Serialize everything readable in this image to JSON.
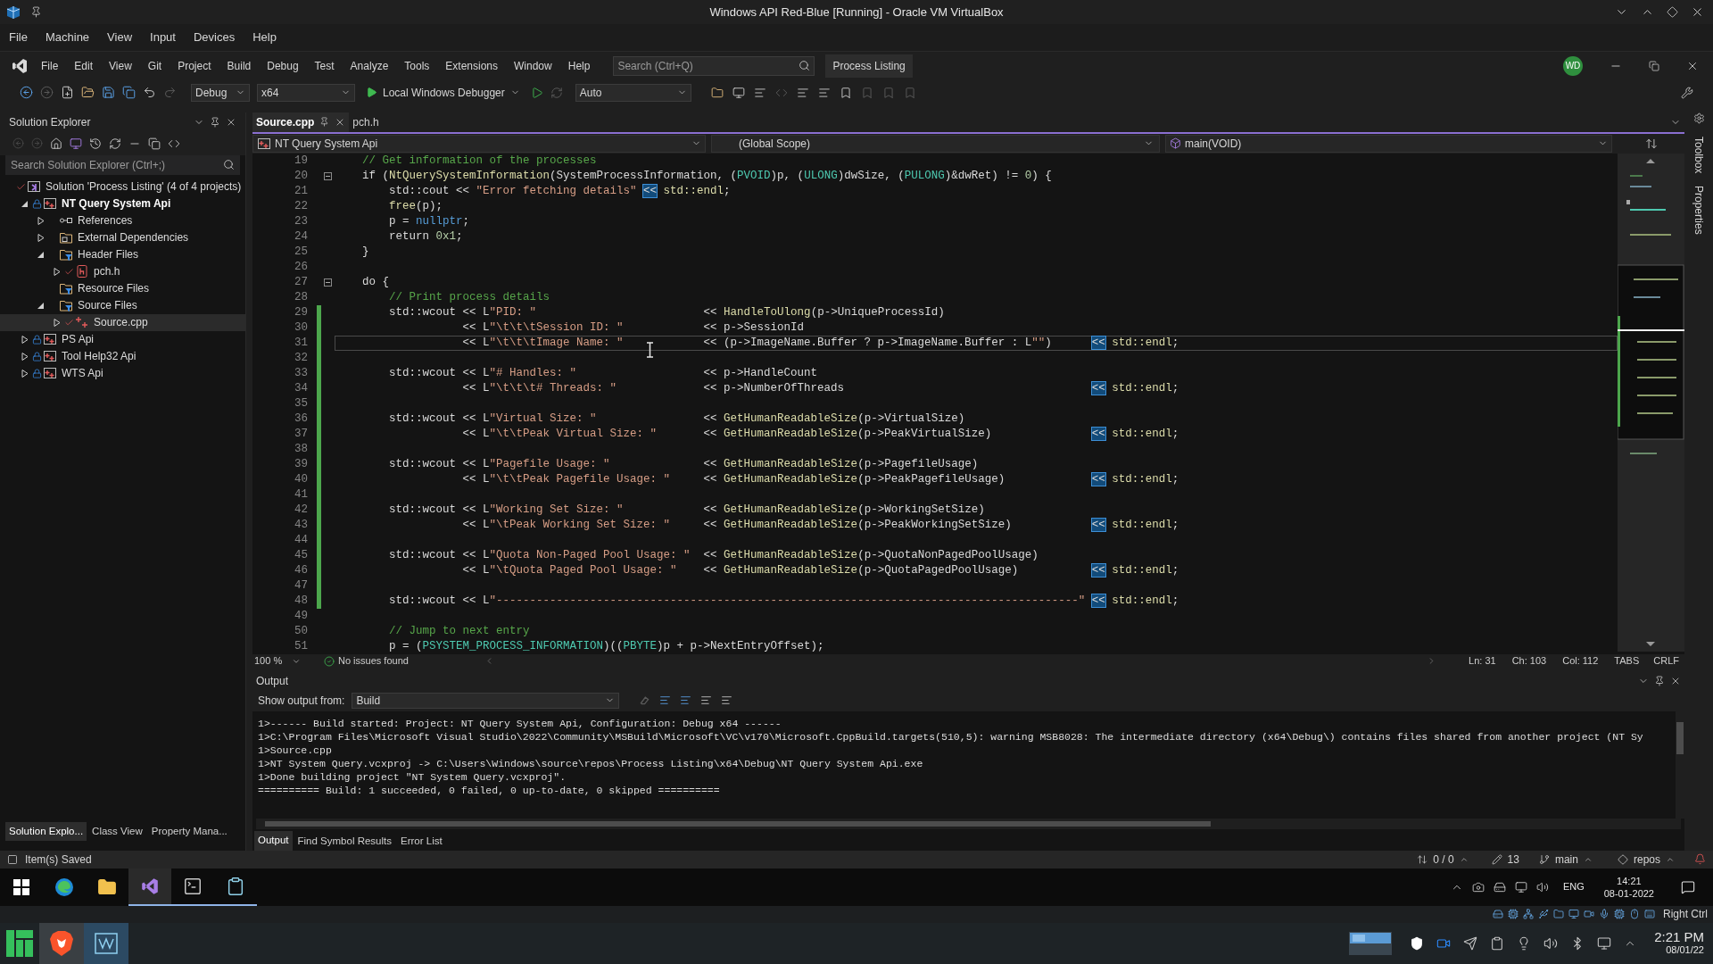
{
  "vbox": {
    "title": "Windows API Red-Blue [Running] - Oracle VM VirtualBox",
    "menu": [
      "File",
      "Machine",
      "View",
      "Input",
      "Devices",
      "Help"
    ]
  },
  "vs": {
    "menu": [
      "File",
      "Edit",
      "View",
      "Git",
      "Project",
      "Build",
      "Debug",
      "Test",
      "Analyze",
      "Tools",
      "Extensions",
      "Window",
      "Help"
    ],
    "search": {
      "placeholder": "Search (Ctrl+Q)"
    },
    "solution_name": "Process Listing",
    "account": "WD",
    "toolbar": {
      "configuration": "Debug",
      "platform": "x64",
      "debugger": "Local Windows Debugger",
      "mode": "Auto"
    },
    "solution_explorer": {
      "title": "Solution Explorer",
      "search": {
        "placeholder": "Search Solution Explorer (Ctrl+;)"
      },
      "tree": [
        {
          "label": "Solution 'Process Listing' (4 of 4 projects)",
          "kind": "solution",
          "selected": false,
          "locked": false,
          "checked_in": true,
          "children": [
            {
              "label": "NT Query System Api",
              "kind": "project",
              "startup": true,
              "expanded": true,
              "selected": false,
              "locked": true,
              "checked_in": false,
              "children": [
                {
                  "label": "References",
                  "kind": "references",
                  "expanded": false,
                  "selected": false,
                  "locked": false,
                  "checked_in": false
                },
                {
                  "label": "External Dependencies",
                  "kind": "dependencies",
                  "expanded": false,
                  "selected": false,
                  "locked": false,
                  "checked_in": false
                },
                {
                  "label": "Header Files",
                  "kind": "filter",
                  "expanded": true,
                  "selected": false,
                  "locked": false,
                  "checked_in": false,
                  "children": [
                    {
                      "label": "pch.h",
                      "kind": "header",
                      "expanded": false,
                      "selected": false,
                      "locked": false,
                      "checked_in": true
                    }
                  ]
                },
                {
                  "label": "Resource Files",
                  "kind": "filter",
                  "selected": false,
                  "locked": false,
                  "checked_in": false
                },
                {
                  "label": "Source Files",
                  "kind": "filter",
                  "expanded": true,
                  "selected": false,
                  "locked": false,
                  "checked_in": false,
                  "children": [
                    {
                      "label": "Source.cpp",
                      "kind": "source",
                      "expanded": false,
                      "selected": true,
                      "locked": false,
                      "checked_in": true
                    }
                  ]
                }
              ]
            },
            {
              "label": "PS Api",
              "kind": "project",
              "startup": false,
              "expanded": false,
              "selected": false,
              "locked": true,
              "checked_in": false
            },
            {
              "label": "Tool Help32 Api",
              "kind": "project",
              "startup": false,
              "expanded": false,
              "selected": false,
              "locked": true,
              "checked_in": false
            },
            {
              "label": "WTS Api",
              "kind": "project",
              "startup": false,
              "expanded": false,
              "selected": false,
              "locked": true,
              "checked_in": false
            }
          ]
        }
      ]
    },
    "left_tabs": [
      {
        "label": "Solution Explo...",
        "selected": true
      },
      {
        "label": "Class View",
        "selected": false
      },
      {
        "label": "Property Mana...",
        "selected": false
      }
    ],
    "editor": {
      "tabs": [
        {
          "label": "Source.cpp",
          "selected": true
        },
        {
          "label": "pch.h",
          "selected": false
        }
      ],
      "nav": [
        "NT Query System Api",
        "(Global Scope)",
        "main(VOID)"
      ],
      "lines": [
        {
          "number": "19",
          "tokens": [
            {
              "kind": "comment",
              "text": "// Get information of the processes"
            }
          ]
        },
        {
          "number": "20",
          "fold": true,
          "tokens": [
            {
              "kind": "plain",
              "text": "if ("
            },
            {
              "kind": "function",
              "text": "NtQuerySystemInformation"
            },
            {
              "kind": "plain",
              "text": "(SystemProcessInformation, ("
            },
            {
              "kind": "type",
              "text": "PVOID"
            },
            {
              "kind": "plain",
              "text": ")p, ("
            },
            {
              "kind": "type",
              "text": "ULONG"
            },
            {
              "kind": "plain",
              "text": ")dwSize, ("
            },
            {
              "kind": "type",
              "text": "PULONG"
            },
            {
              "kind": "plain",
              "text": ")&dwRet) != "
            },
            {
              "kind": "number",
              "text": "0"
            },
            {
              "kind": "plain",
              "text": ") {"
            }
          ]
        },
        {
          "number": "21",
          "tokens": [
            {
              "kind": "plain",
              "text": "    std::cout << "
            },
            {
              "kind": "string",
              "text": "\"Error fetching details\" "
            },
            {
              "kind": "match",
              "text": "<<"
            },
            {
              "kind": "function",
              "text": " std::endl"
            },
            {
              "kind": "plain",
              "text": ";"
            }
          ]
        },
        {
          "number": "22",
          "tokens": [
            {
              "kind": "function",
              "text": "    free"
            },
            {
              "kind": "plain",
              "text": "(p);"
            }
          ]
        },
        {
          "number": "23",
          "tokens": [
            {
              "kind": "plain",
              "text": "    p = "
            },
            {
              "kind": "keyword",
              "text": "nullptr"
            },
            {
              "kind": "plain",
              "text": ";"
            }
          ]
        },
        {
          "number": "24",
          "tokens": [
            {
              "kind": "plain",
              "text": "    return "
            },
            {
              "kind": "number",
              "text": "0x1"
            },
            {
              "kind": "plain",
              "text": ";"
            }
          ]
        },
        {
          "number": "25",
          "tokens": [
            {
              "kind": "plain",
              "text": "}"
            }
          ]
        },
        {
          "number": "26"
        },
        {
          "number": "27",
          "fold": true,
          "tokens": [
            {
              "kind": "plain",
              "text": "do {"
            }
          ]
        },
        {
          "number": "28",
          "tokens": [
            {
              "kind": "comment",
              "text": "    // Print process details"
            }
          ]
        },
        {
          "number": "29",
          "changed": true,
          "tokens": [
            {
              "kind": "plain",
              "text": "    std::wcout << L"
            },
            {
              "kind": "string",
              "text": "\"PID: \""
            },
            {
              "kind": "plain",
              "text": "                         << "
            },
            {
              "kind": "function",
              "text": "HandleToUlong"
            },
            {
              "kind": "plain",
              "text": "(p->UniqueProcessId)"
            }
          ]
        },
        {
          "number": "30",
          "changed": true,
          "tokens": [
            {
              "kind": "plain",
              "text": "               << L"
            },
            {
              "kind": "string",
              "text": "\"\\t\\t\\tSession ID: \""
            },
            {
              "kind": "plain",
              "text": "            << p->SessionId"
            }
          ]
        },
        {
          "number": "31",
          "changed": true,
          "current": true,
          "tokens": [
            {
              "kind": "plain",
              "text": "               << L"
            },
            {
              "kind": "string",
              "text": "\"\\t\\t\\tImage Name: \""
            },
            {
              "kind": "plain",
              "text": "            << (p->ImageName.Buffer ? p->ImageName.Buffer : L"
            },
            {
              "kind": "string",
              "text": "\"\""
            },
            {
              "kind": "plain",
              "text": ")      "
            },
            {
              "kind": "match",
              "text": "<<"
            },
            {
              "kind": "function",
              "text": " std::endl"
            },
            {
              "kind": "plain",
              "text": ";"
            }
          ]
        },
        {
          "number": "32",
          "changed": true
        },
        {
          "number": "33",
          "changed": true,
          "tokens": [
            {
              "kind": "plain",
              "text": "    std::wcout << L"
            },
            {
              "kind": "string",
              "text": "\"# Handles: \""
            },
            {
              "kind": "plain",
              "text": "                   << p->HandleCount"
            }
          ]
        },
        {
          "number": "34",
          "changed": true,
          "tokens": [
            {
              "kind": "plain",
              "text": "               << L"
            },
            {
              "kind": "string",
              "text": "\"\\t\\t\\t# Threads: \""
            },
            {
              "kind": "plain",
              "text": "             << p->NumberOfThreads                                     "
            },
            {
              "kind": "match",
              "text": "<<"
            },
            {
              "kind": "function",
              "text": " std::endl"
            },
            {
              "kind": "plain",
              "text": ";"
            }
          ]
        },
        {
          "number": "35",
          "changed": true
        },
        {
          "number": "36",
          "changed": true,
          "tokens": [
            {
              "kind": "plain",
              "text": "    std::wcout << L"
            },
            {
              "kind": "string",
              "text": "\"Virtual Size: \""
            },
            {
              "kind": "plain",
              "text": "                << "
            },
            {
              "kind": "function",
              "text": "GetHumanReadableSize"
            },
            {
              "kind": "plain",
              "text": "(p->VirtualSize)"
            }
          ]
        },
        {
          "number": "37",
          "changed": true,
          "tokens": [
            {
              "kind": "plain",
              "text": "               << L"
            },
            {
              "kind": "string",
              "text": "\"\\t\\tPeak Virtual Size: \""
            },
            {
              "kind": "plain",
              "text": "       << "
            },
            {
              "kind": "function",
              "text": "GetHumanReadableSize"
            },
            {
              "kind": "plain",
              "text": "(p->PeakVirtualSize)               "
            },
            {
              "kind": "match",
              "text": "<<"
            },
            {
              "kind": "function",
              "text": " std::endl"
            },
            {
              "kind": "plain",
              "text": ";"
            }
          ]
        },
        {
          "number": "38",
          "changed": true
        },
        {
          "number": "39",
          "changed": true,
          "tokens": [
            {
              "kind": "plain",
              "text": "    std::wcout << L"
            },
            {
              "kind": "string",
              "text": "\"Pagefile Usage: \""
            },
            {
              "kind": "plain",
              "text": "              << "
            },
            {
              "kind": "function",
              "text": "GetHumanReadableSize"
            },
            {
              "kind": "plain",
              "text": "(p->PagefileUsage)"
            }
          ]
        },
        {
          "number": "40",
          "changed": true,
          "tokens": [
            {
              "kind": "plain",
              "text": "               << L"
            },
            {
              "kind": "string",
              "text": "\"\\t\\tPeak Pagefile Usage: \""
            },
            {
              "kind": "plain",
              "text": "     << "
            },
            {
              "kind": "function",
              "text": "GetHumanReadableSize"
            },
            {
              "kind": "plain",
              "text": "(p->PeakPagefileUsage)             "
            },
            {
              "kind": "match",
              "text": "<<"
            },
            {
              "kind": "function",
              "text": " std::endl"
            },
            {
              "kind": "plain",
              "text": ";"
            }
          ]
        },
        {
          "number": "41",
          "changed": true
        },
        {
          "number": "42",
          "changed": true,
          "tokens": [
            {
              "kind": "plain",
              "text": "    std::wcout << L"
            },
            {
              "kind": "string",
              "text": "\"Working Set Size: \""
            },
            {
              "kind": "plain",
              "text": "            << "
            },
            {
              "kind": "function",
              "text": "GetHumanReadableSize"
            },
            {
              "kind": "plain",
              "text": "(p->WorkingSetSize)"
            }
          ]
        },
        {
          "number": "43",
          "changed": true,
          "tokens": [
            {
              "kind": "plain",
              "text": "               << L"
            },
            {
              "kind": "string",
              "text": "\"\\tPeak Working Set Size: \""
            },
            {
              "kind": "plain",
              "text": "     << "
            },
            {
              "kind": "function",
              "text": "GetHumanReadableSize"
            },
            {
              "kind": "plain",
              "text": "(p->PeakWorkingSetSize)            "
            },
            {
              "kind": "match",
              "text": "<<"
            },
            {
              "kind": "function",
              "text": " std::endl"
            },
            {
              "kind": "plain",
              "text": ";"
            }
          ]
        },
        {
          "number": "44",
          "changed": true
        },
        {
          "number": "45",
          "changed": true,
          "tokens": [
            {
              "kind": "plain",
              "text": "    std::wcout << L"
            },
            {
              "kind": "string",
              "text": "\"Quota Non-Paged Pool Usage: \""
            },
            {
              "kind": "plain",
              "text": "  << "
            },
            {
              "kind": "function",
              "text": "GetHumanReadableSize"
            },
            {
              "kind": "plain",
              "text": "(p->QuotaNonPagedPoolUsage)"
            }
          ]
        },
        {
          "number": "46",
          "changed": true,
          "tokens": [
            {
              "kind": "plain",
              "text": "               << L"
            },
            {
              "kind": "string",
              "text": "\"\\tQuota Paged Pool Usage: \""
            },
            {
              "kind": "plain",
              "text": "    << "
            },
            {
              "kind": "function",
              "text": "GetHumanReadableSize"
            },
            {
              "kind": "plain",
              "text": "(p->QuotaPagedPoolUsage)           "
            },
            {
              "kind": "match",
              "text": "<<"
            },
            {
              "kind": "function",
              "text": " std::endl"
            },
            {
              "kind": "plain",
              "text": ";"
            }
          ]
        },
        {
          "number": "47",
          "changed": true
        },
        {
          "number": "48",
          "changed": true,
          "tokens": [
            {
              "kind": "plain",
              "text": "    std::wcout << L"
            },
            {
              "kind": "string",
              "text": "\"---------------------------------------------------------------------------------------\" "
            },
            {
              "kind": "match",
              "text": "<<"
            },
            {
              "kind": "function",
              "text": " std::endl"
            },
            {
              "kind": "plain",
              "text": ";"
            }
          ]
        },
        {
          "number": "49"
        },
        {
          "number": "50",
          "tokens": [
            {
              "kind": "comment",
              "text": "    // Jump to next entry"
            }
          ]
        },
        {
          "number": "51",
          "tokens": [
            {
              "kind": "plain",
              "text": "    p = ("
            },
            {
              "kind": "type",
              "text": "PSYSTEM_PROCESS_INFORMATION"
            },
            {
              "kind": "plain",
              "text": ")(("
            },
            {
              "kind": "type",
              "text": "PBYTE"
            },
            {
              "kind": "plain",
              "text": ")p + p->NextEntryOffset);"
            }
          ]
        }
      ],
      "status": {
        "zoom": "100 %",
        "issues": "No issues found",
        "line": "Ln: 31",
        "char": "Ch: 103",
        "column": "Col: 112",
        "indent": "TABS",
        "line_endings": "CRLF"
      }
    },
    "output": {
      "title": "Output",
      "source_label": "Show output from:",
      "source": "Build",
      "lines": [
        "1>------ Build started: Project: NT Query System Api, Configuration: Debug x64 ------",
        "1>C:\\Program Files\\Microsoft Visual Studio\\2022\\Community\\MSBuild\\Microsoft\\VC\\v170\\Microsoft.CppBuild.targets(510,5): warning MSB8028: The intermediate directory (x64\\Debug\\) contains files shared from another project (NT Sy",
        "1>Source.cpp",
        "1>NT System Query.vcxproj -> C:\\Users\\Windows\\source\\repos\\Process Listing\\x64\\Debug\\NT Query System Api.exe",
        "1>Done building project \"NT System Query.vcxproj\".",
        "========== Build: 1 succeeded, 0 failed, 0 up-to-date, 0 skipped =========="
      ],
      "tabs": [
        {
          "label": "Output",
          "selected": true
        },
        {
          "label": "Find Symbol Results",
          "selected": false
        },
        {
          "label": "Error List",
          "selected": false
        }
      ]
    },
    "side_strip": [
      "Toolbox",
      "Properties"
    ],
    "status_bar": {
      "message": "Item(s) Saved",
      "changes": "0 / 0",
      "edits": "13",
      "branch": "main",
      "repository": "repos"
    }
  },
  "guest_taskbar": {
    "language": "ENG",
    "time": "14:21",
    "date": "08-01-2022"
  },
  "vbox_status": {
    "host_key": "Right Ctrl"
  },
  "host_taskbar": {
    "time": "2:21 PM",
    "date": "08/01/22"
  }
}
